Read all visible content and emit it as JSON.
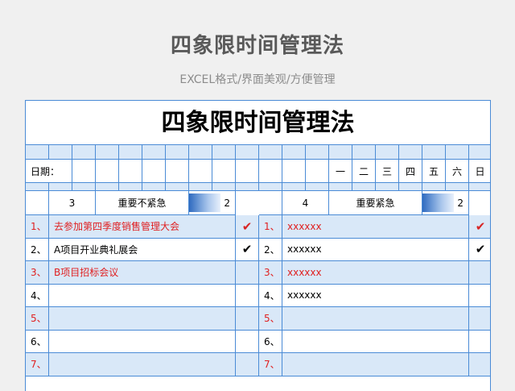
{
  "header": {
    "title": "四象限时间管理法",
    "subtitle": "EXCEL格式/界面美观/方便管理"
  },
  "sheet": {
    "title": "四象限时间管理法",
    "date_label": "日期：",
    "weekdays": [
      "一",
      "二",
      "三",
      "四",
      "五",
      "六",
      "日"
    ],
    "left_quadrant": {
      "number": "3",
      "label": "重要不紧急",
      "progress_value": "2"
    },
    "right_quadrant": {
      "number": "4",
      "label": "重要紧急",
      "progress_value": "2"
    },
    "left_items": [
      {
        "index": "1、",
        "text": "去参加第四季度销售管理大会",
        "checked": true,
        "check_color": "red",
        "red": true
      },
      {
        "index": "2、",
        "text": "A项目开业典礼展会",
        "checked": true,
        "check_color": "black",
        "red": false
      },
      {
        "index": "3、",
        "text": "B项目招标会议",
        "checked": false,
        "red": true
      },
      {
        "index": "4、",
        "text": "",
        "checked": false,
        "red": false
      },
      {
        "index": "5、",
        "text": "",
        "checked": false,
        "red": true
      },
      {
        "index": "6、",
        "text": "",
        "checked": false,
        "red": false
      },
      {
        "index": "7、",
        "text": "",
        "checked": false,
        "red": true
      }
    ],
    "right_items": [
      {
        "index": "1、",
        "text": "xxxxxx",
        "checked": true,
        "check_color": "red",
        "red": true
      },
      {
        "index": "2、",
        "text": "xxxxxx",
        "checked": true,
        "check_color": "black",
        "red": false
      },
      {
        "index": "3、",
        "text": "xxxxxx",
        "checked": false,
        "red": true
      },
      {
        "index": "4、",
        "text": "xxxxxx",
        "checked": false,
        "red": false
      },
      {
        "index": "5、",
        "text": "",
        "checked": false,
        "red": true
      },
      {
        "index": "6、",
        "text": "",
        "checked": false,
        "red": false
      },
      {
        "index": "7、",
        "text": "",
        "checked": false,
        "red": true
      }
    ],
    "check_glyph": "✔"
  }
}
